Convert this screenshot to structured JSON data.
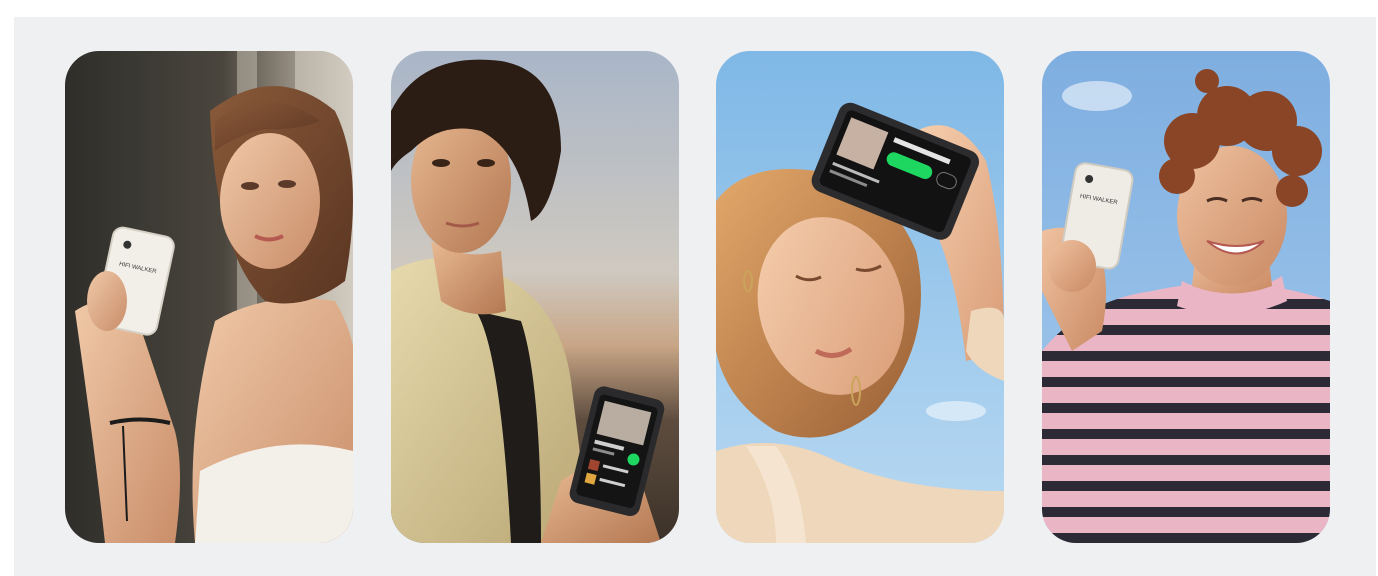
{
  "gallery": {
    "cards": [
      {
        "id": "card-1",
        "device_print": "HIFI WALKER"
      },
      {
        "id": "card-2",
        "device_print": ""
      },
      {
        "id": "card-3",
        "device_print": ""
      },
      {
        "id": "card-4",
        "device_print": "HIFI WALKER"
      }
    ]
  },
  "colors": {
    "panel_bg": "#eff0f2",
    "spotify_green": "#1ed760"
  }
}
